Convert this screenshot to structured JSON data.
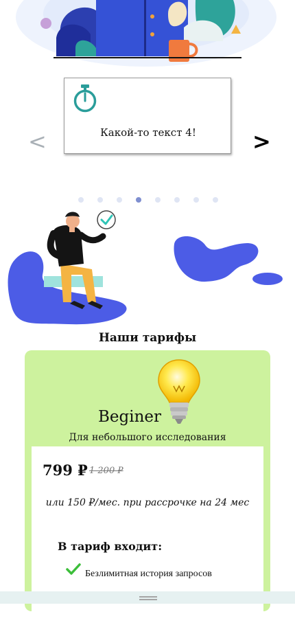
{
  "slider": {
    "slide_text": "Какой-то текст 4!",
    "prev_label": "<",
    "next_label": ">",
    "dot_count": 8,
    "active_dot": 4
  },
  "tariffs": {
    "section_title": "Наши тарифы",
    "plan": {
      "name": "Beginer",
      "subtitle": "Для небольшого исследования",
      "price": "799 ₽",
      "old_price": "1 200 ₽",
      "installment": "или 150 ₽/мес. при рассрочке на 24 мес",
      "includes_title": "В тариф входит:",
      "features": [
        "Безлимитная история запросов"
      ]
    }
  },
  "colors": {
    "accent_blue": "#4c5ce6",
    "card_green": "#cdf29e",
    "check_green": "#3cbe3a",
    "timer_teal": "#2a9d9a"
  },
  "icons": [
    "timer-icon",
    "lightbulb-icon",
    "check-icon",
    "drag-handle-icon"
  ]
}
